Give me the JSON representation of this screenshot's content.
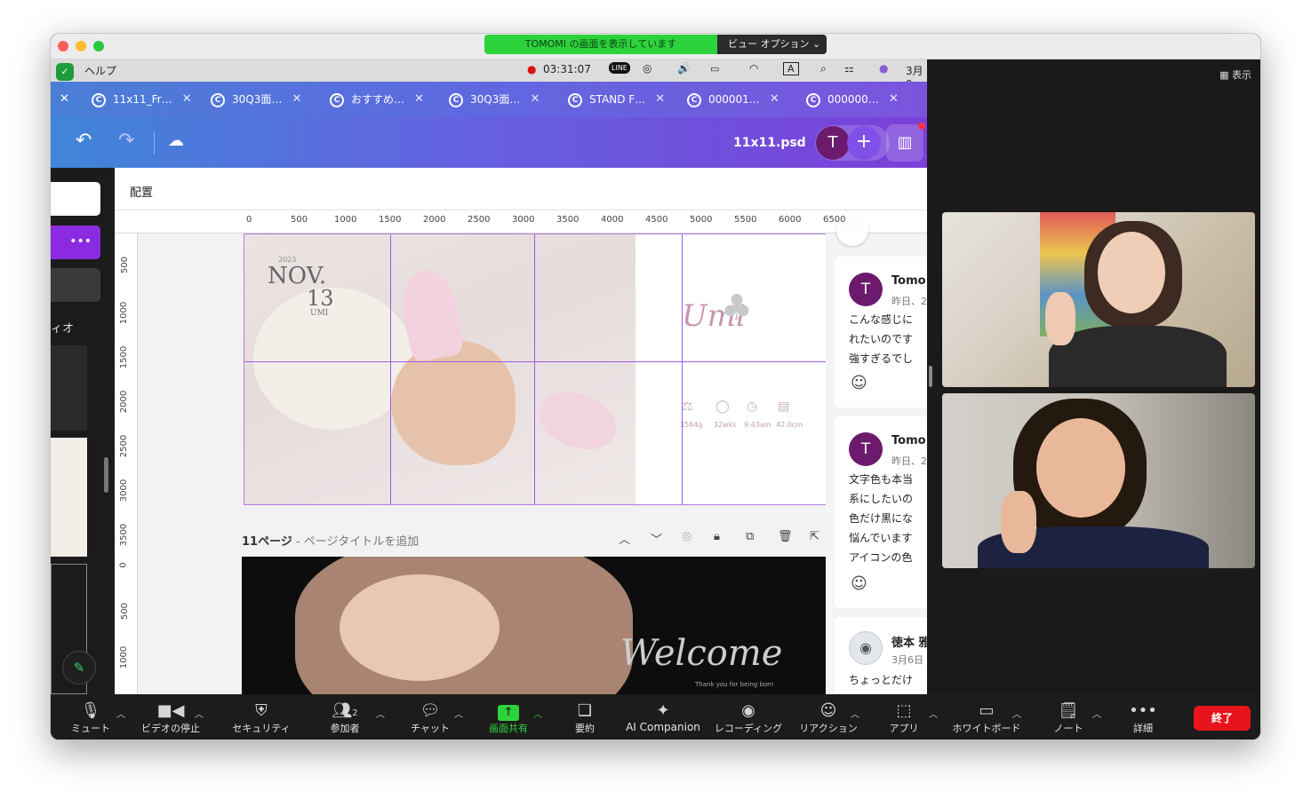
{
  "share_banner": {
    "text": "TOMOMI の画面を表示しています",
    "options_label": "ビュー オプション"
  },
  "view_label": "表示",
  "menubar": {
    "help": "ヘルプ",
    "timer": "03:31:07",
    "input_indicator": "A",
    "date": "3月9"
  },
  "browser_tabs": [
    {
      "label": "11x11_Fr…"
    },
    {
      "label": "30Q3面…"
    },
    {
      "label": "おすすめ…"
    },
    {
      "label": "30Q3面…"
    },
    {
      "label": "STAND F…"
    },
    {
      "label": "000001…"
    },
    {
      "label": "000000…"
    }
  ],
  "canva": {
    "filename": "11x11.psd",
    "avatar_letter": "T",
    "panel_title": "配置",
    "left_label": "ィオ",
    "ruler_h": [
      "0",
      "500",
      "1000",
      "1500",
      "2000",
      "2500",
      "3000",
      "3500",
      "4000",
      "4500",
      "5000",
      "5500",
      "6000",
      "6500"
    ],
    "ruler_v": [
      "500",
      "1000",
      "1500",
      "2000",
      "2500",
      "3000",
      "3500",
      "0",
      "500",
      "1000"
    ],
    "page_label": "11ページ",
    "page_title_placeholder": " - ページタイトルを追加",
    "design": {
      "year": "2023",
      "month": "NOV.",
      "day": "13",
      "name_small": "UMI",
      "script_name": "Umi",
      "stats": [
        "3584g",
        "32wks",
        "9:43am",
        "42.0cm"
      ],
      "welcome": "Welcome",
      "welcome_sub": "Thank you for being born"
    },
    "comments": [
      {
        "avatar": "T",
        "name": "Tomo",
        "time": "昨日、2",
        "lines": [
          "こんな感じに",
          "れたいのです",
          "強すぎるでし"
        ]
      },
      {
        "avatar": "T",
        "name": "Tomo",
        "time": "昨日、2",
        "lines": [
          "文字色も本当",
          "系にしたいの",
          "色だけ黒にな",
          "悩んでいます",
          "アイコンの色"
        ]
      },
      {
        "avatar": "",
        "name": "徳本 雅",
        "time": "3月6日",
        "lines": [
          "ちょっとだけ"
        ]
      }
    ]
  },
  "zoom_toolbar": [
    {
      "label": "ミュート",
      "icon": "mic-icon"
    },
    {
      "label": "ビデオの停止",
      "icon": "video-camera-icon"
    },
    {
      "label": "セキュリティ",
      "icon": "shield-icon"
    },
    {
      "label": "参加者",
      "icon": "participants-icon",
      "count": "2"
    },
    {
      "label": "チャット",
      "icon": "chat-icon"
    },
    {
      "label": "画面共有",
      "icon": "share-screen-icon"
    },
    {
      "label": "要約",
      "icon": "summary-icon"
    },
    {
      "label": "AI Companion",
      "icon": "ai-sparkle-icon"
    },
    {
      "label": "レコーディング",
      "icon": "record-icon"
    },
    {
      "label": "リアクション",
      "icon": "reaction-icon"
    },
    {
      "label": "アプリ",
      "icon": "apps-icon"
    },
    {
      "label": "ホワイトボード",
      "icon": "whiteboard-icon"
    },
    {
      "label": "ノート",
      "icon": "notes-icon"
    },
    {
      "label": "詳細",
      "icon": "more-icon"
    }
  ],
  "end_button": "終了",
  "colors": {
    "share_green": "#2dd33c",
    "end_red": "#e8141b",
    "canva_purple": "#7b3fd8"
  }
}
